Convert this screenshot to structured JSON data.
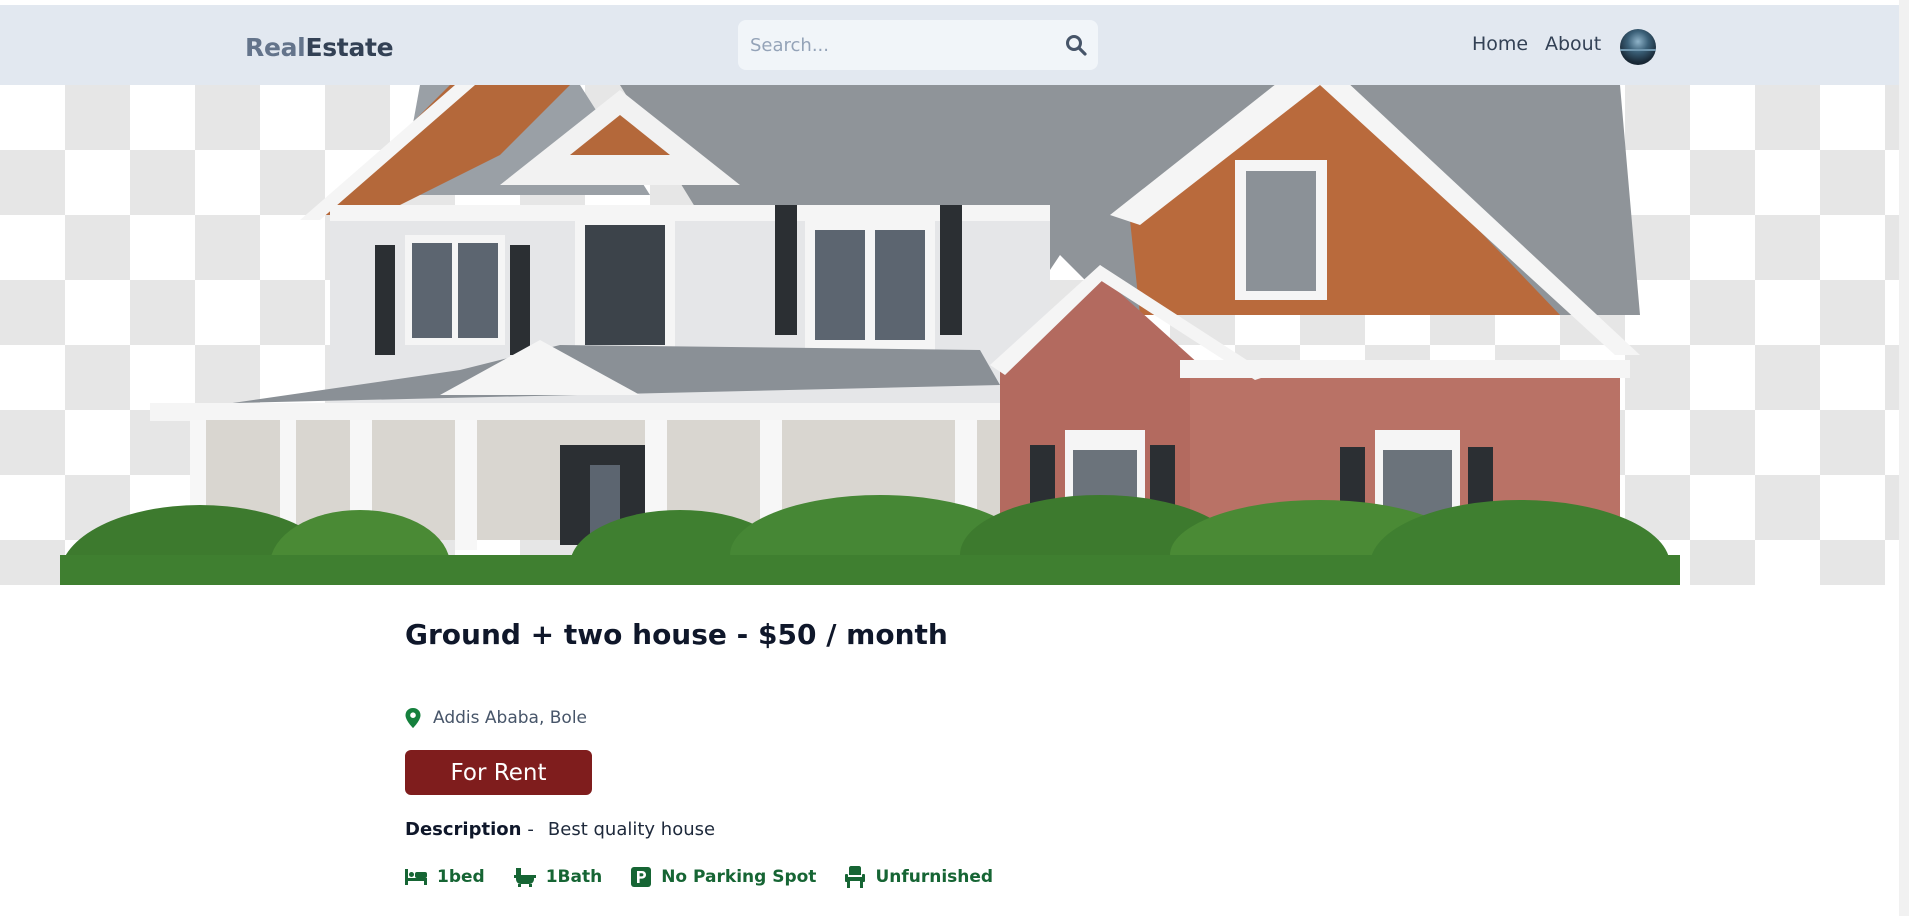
{
  "header": {
    "logo_part1": "Real",
    "logo_part2": "Estate",
    "search_placeholder": "Search...",
    "nav": {
      "home": "Home",
      "about": "About"
    }
  },
  "listing": {
    "title": "Ground + two house - $50 / month",
    "location": "Addis Ababa, Bole",
    "status_badge": "For Rent",
    "description_label": "Description",
    "description_separator": "-",
    "description_text": "Best quality house",
    "features": {
      "bedrooms": "1bed",
      "bathrooms": "1Bath",
      "parking": "No Parking Spot",
      "furnished": "Unfurnished"
    }
  },
  "colors": {
    "header_bg": "#e2e8f0",
    "badge_bg": "#7f1d1d",
    "feature_green": "#166534",
    "location_pin": "#15803d"
  },
  "icons": [
    "search-icon",
    "location-pin-icon",
    "bed-icon",
    "bath-icon",
    "parking-icon",
    "chair-icon"
  ]
}
